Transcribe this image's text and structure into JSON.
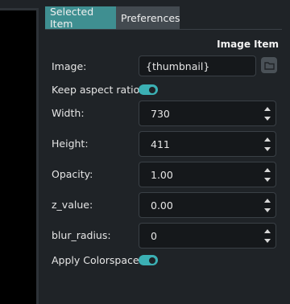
{
  "tabs": [
    {
      "label": "Selected Item",
      "active": true
    },
    {
      "label": "Preferences",
      "active": false
    }
  ],
  "panel": {
    "section_title": "Image Item",
    "image": {
      "label": "Image:",
      "value": "{thumbnail}"
    },
    "keep_aspect": {
      "label": "Keep aspect ratio:",
      "on": true
    },
    "width": {
      "label": "Width:",
      "value": "730"
    },
    "height": {
      "label": "Height:",
      "value": "411"
    },
    "opacity": {
      "label": "Opacity:",
      "value": "1.00"
    },
    "z_value": {
      "label": "z_value:",
      "value": "0.00"
    },
    "blur_radius": {
      "label": "blur_radius:",
      "value": "0"
    },
    "apply_colorspace": {
      "label": "Apply Colorspace:",
      "on": true
    }
  },
  "colors": {
    "accent": "#3f8f91",
    "toggle": "#3bb0b4",
    "background": "#1f2327",
    "field": "#15181b"
  },
  "icons": {
    "folder": "folder-icon",
    "up": "chevron-up-icon",
    "down": "chevron-down-icon"
  }
}
